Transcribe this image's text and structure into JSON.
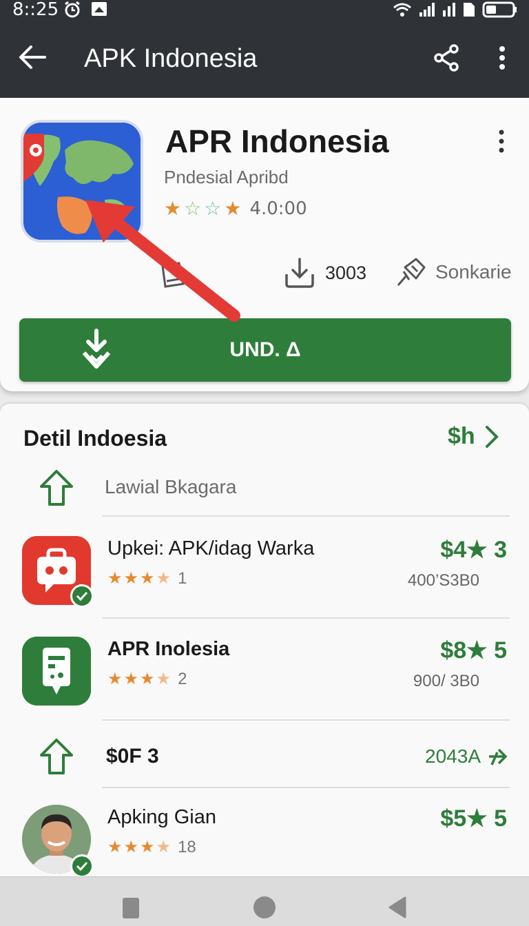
{
  "status_bar": {
    "time": "8::25"
  },
  "app_bar": {
    "title": "APK Indonesia"
  },
  "app": {
    "name": "APR Indonesia",
    "developer": "Pndesial Apribd",
    "rating": "4.0:00",
    "download_count": "3003",
    "tag_label": "Sonkarie",
    "install_label": "UND. Δ",
    "icon": "world-map-icon"
  },
  "details": {
    "title": "Detil Indoesia",
    "link_label": "$h",
    "sub_label": "Lawial Bkagara"
  },
  "items": [
    {
      "title": "Upkei: APK/idag Warka",
      "price": "$4★ 3",
      "rating_count": "1",
      "meta": "400’S3B0",
      "icon": "robot-icon"
    },
    {
      "title": "APR Inolesia",
      "price": "$8★ 5",
      "rating_count": "2",
      "meta": "900/ 3B0",
      "icon": "device-icon"
    }
  ],
  "update_row": {
    "label": "$0F 3",
    "value": "2043A"
  },
  "last_item": {
    "title": "Apking Gian",
    "price": "$5★ 5",
    "rating_count": "18",
    "icon": "avatar"
  },
  "colors": {
    "accent_green": "#2e7d3a",
    "app_bar": "#2f3338",
    "star_orange": "#e48a2e",
    "arrow_red": "#e43a36"
  }
}
